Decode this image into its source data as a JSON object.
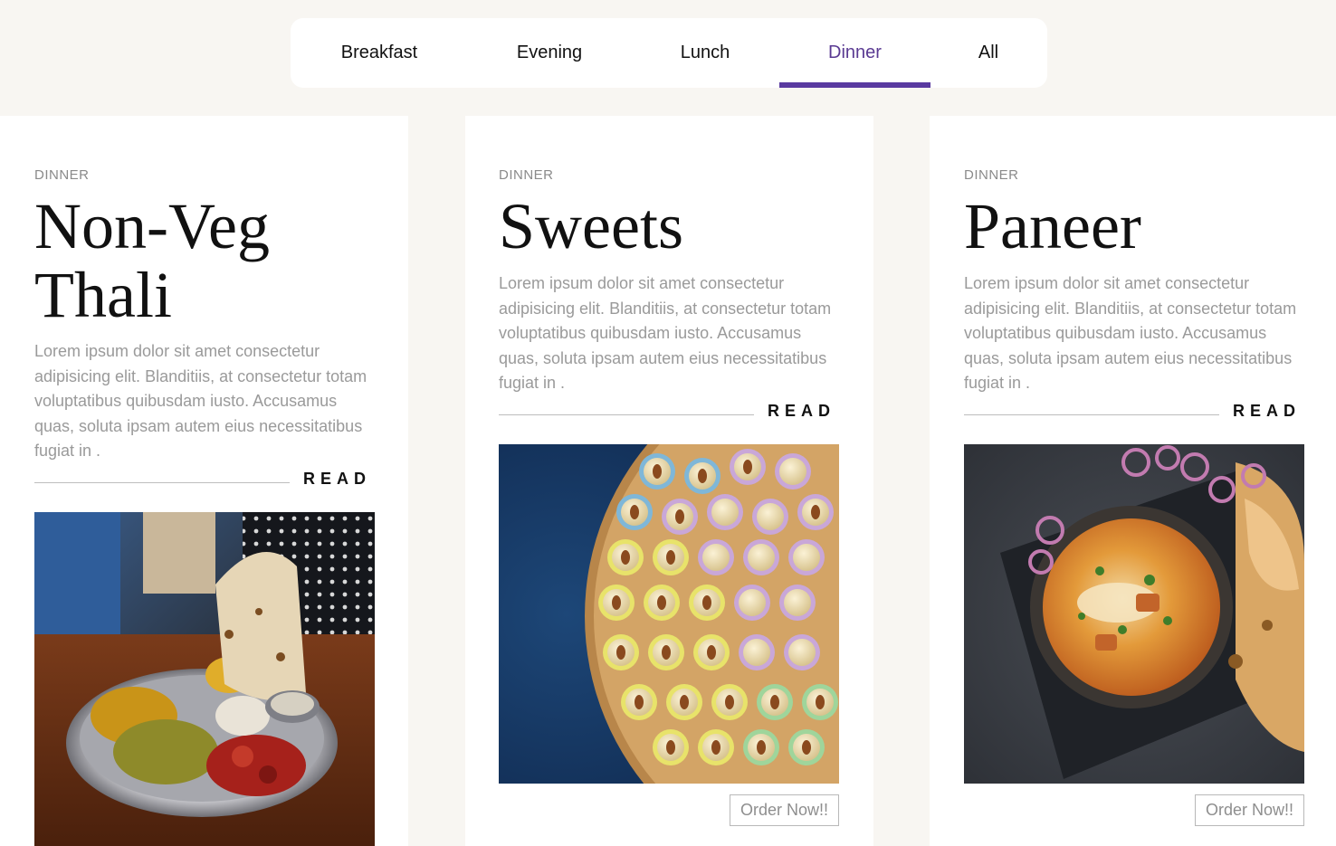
{
  "tabs": {
    "items": [
      {
        "label": "Breakfast"
      },
      {
        "label": "Evening"
      },
      {
        "label": "Lunch"
      },
      {
        "label": "Dinner"
      },
      {
        "label": "All"
      }
    ],
    "active": "Dinner",
    "accent_color": "#5a3aa0"
  },
  "cards": [
    {
      "category": "DINNER",
      "title": "Non-Veg Thali",
      "description": "Lorem ipsum dolor sit amet consectetur adipisicing elit. Blanditiis, at consectetur totam voluptatibus quibusdam iusto. Accusamus quas, soluta ipsam autem eius necessitatibus fugiat in .",
      "read_label": "READ",
      "image_alt": "Thali plate with curries, rice and roti"
    },
    {
      "category": "DINNER",
      "title": "Sweets",
      "description": "Lorem ipsum dolor sit amet consectetur adipisicing elit. Blanditiis, at consectetur totam voluptatibus quibusdam iusto. Accusamus quas, soluta ipsam autem eius necessitatibus fugiat in .",
      "read_label": "READ",
      "image_alt": "Tray of laddoo sweets in colorful paper cups",
      "order_label": "Order Now!!"
    },
    {
      "category": "DINNER",
      "title": "Paneer",
      "description": "Lorem ipsum dolor sit amet consectetur adipisicing elit. Blanditiis, at consectetur totam voluptatibus quibusdam iusto. Accusamus quas, soluta ipsam autem eius necessitatibus fugiat in .",
      "read_label": "READ",
      "image_alt": "Paneer curry bowl with naan and onion rings",
      "order_label": "Order Now!!"
    }
  ]
}
